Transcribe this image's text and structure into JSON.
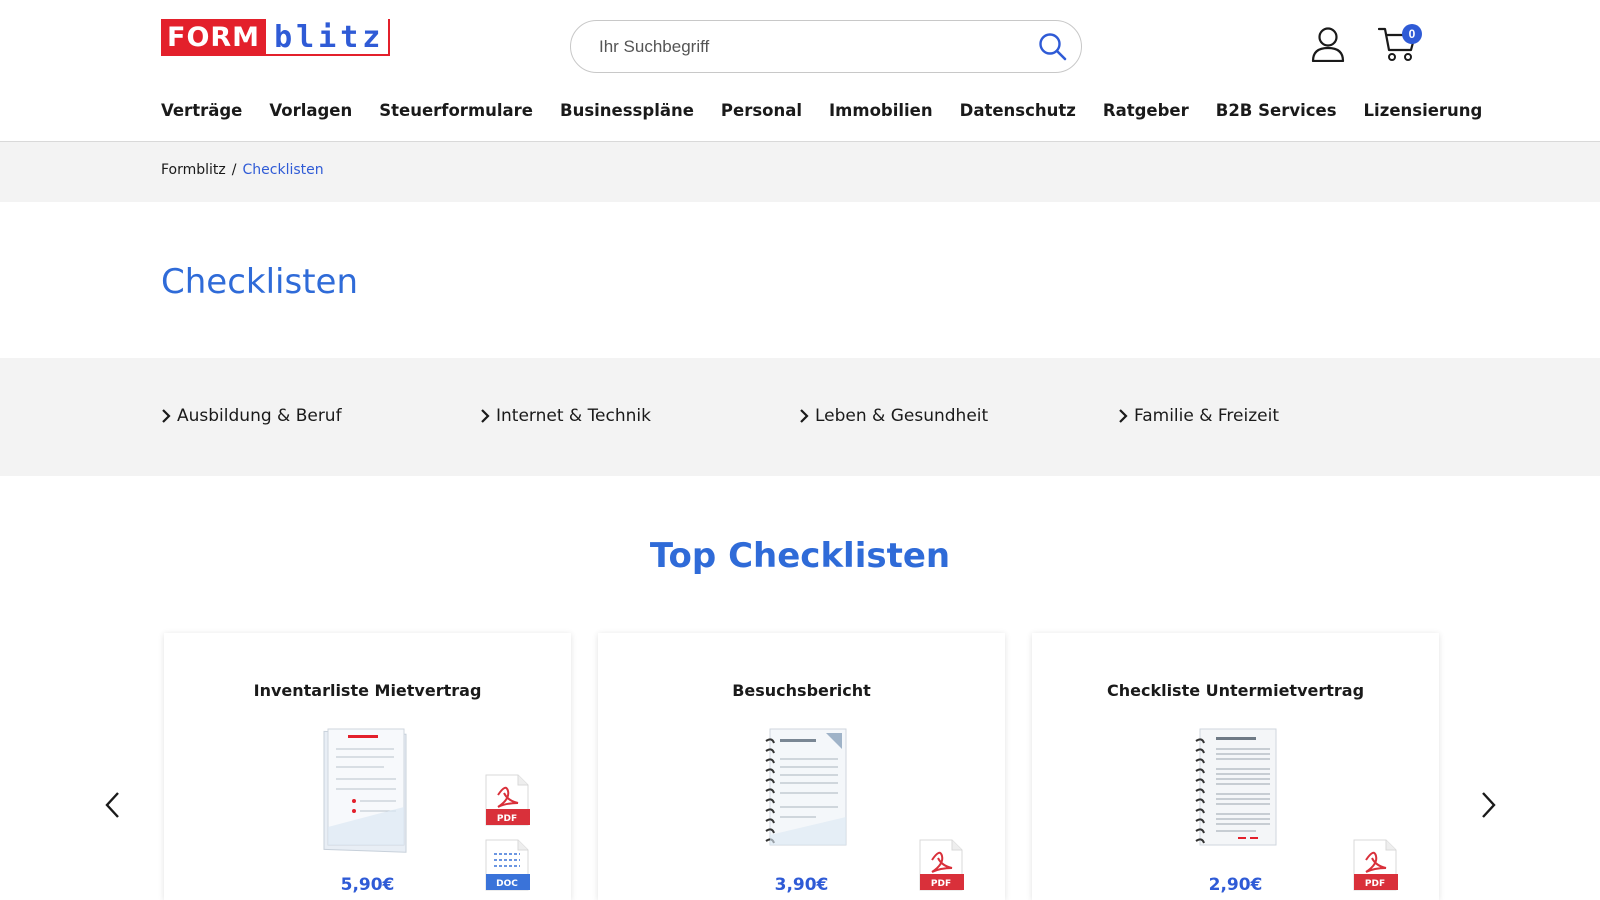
{
  "header": {
    "logo_form": "FORM",
    "logo_blitz": "blitz",
    "search_placeholder": "Ihr Suchbegriff",
    "cart_count": "0"
  },
  "nav": [
    "Verträge",
    "Vorlagen",
    "Steuerformulare",
    "Businesspläne",
    "Personal",
    "Immobilien",
    "Datenschutz",
    "Ratgeber",
    "B2B Services",
    "Lizensierung"
  ],
  "breadcrumb": {
    "root": "Formblitz",
    "separator": "/",
    "current": "Checklisten"
  },
  "page_title": "Checklisten",
  "categories": [
    "Ausbildung & Beruf",
    "Internet & Technik",
    "Leben & Gesundheit",
    "Familie & Freizeit"
  ],
  "section_title": "Top Checklisten",
  "products": [
    {
      "title": "Inventarliste Mietvertrag",
      "price": "5,90€",
      "formats": [
        "PDF",
        "DOC"
      ]
    },
    {
      "title": "Besuchsbericht",
      "price": "3,90€",
      "formats": [
        "PDF"
      ]
    },
    {
      "title": "Checkliste Untermietvertrag",
      "price": "2,90€",
      "formats": [
        "PDF"
      ]
    }
  ],
  "icons": {
    "search": "search-icon",
    "user": "user-icon",
    "cart": "cart-icon",
    "chevron": "chevron-right-icon",
    "prev": "chevron-left-icon",
    "next": "chevron-right-icon"
  },
  "colors": {
    "brand_red": "#e3202b",
    "brand_blue": "#2f5bd6",
    "title_blue": "#2f6bd8",
    "pdf_red": "#d9303a",
    "doc_blue": "#3a73d9"
  }
}
